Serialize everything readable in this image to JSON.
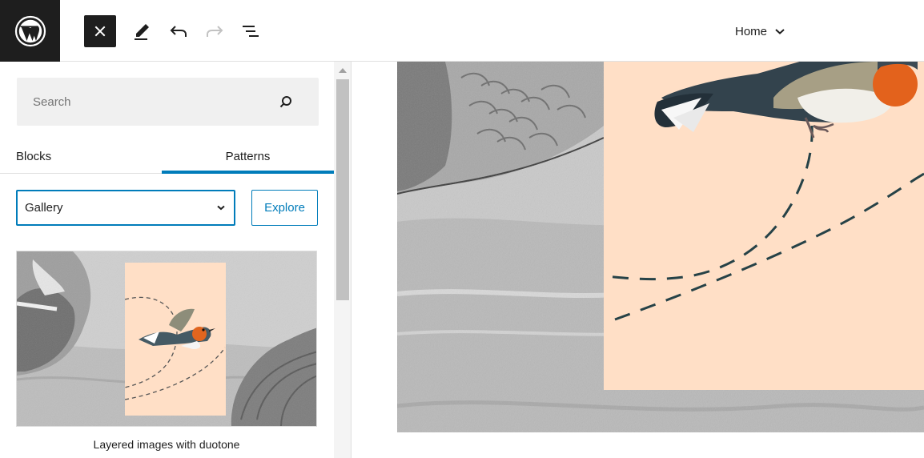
{
  "toolbar": {
    "logo_icon": "wordpress-logo-icon",
    "close_icon": "close-icon",
    "edit_icon": "pencil-icon",
    "undo_icon": "undo-icon",
    "redo_icon": "redo-icon",
    "outline_icon": "list-view-icon",
    "document_title": "Home",
    "title_dropdown_icon": "chevron-down-icon"
  },
  "sidebar": {
    "search": {
      "placeholder": "Search",
      "value": "",
      "icon": "search-icon"
    },
    "tabs": [
      {
        "label": "Blocks",
        "active": false
      },
      {
        "label": "Patterns",
        "active": true
      }
    ],
    "category": {
      "selected": "Gallery",
      "icon": "chevron-down-icon"
    },
    "explore_label": "Explore",
    "patterns": [
      {
        "label": "Layered images with duotone"
      }
    ]
  },
  "colors": {
    "accent": "#007cba",
    "dark": "#1e1e1e",
    "peach": "#ffdfc6",
    "dashed_line": "#264247"
  }
}
